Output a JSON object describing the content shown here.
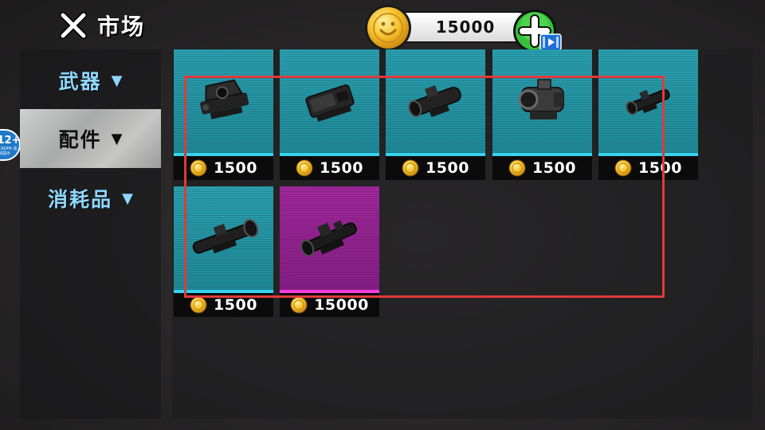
{
  "header": {
    "title": "市场",
    "close_icon": "close-x-icon"
  },
  "currency": {
    "coins": "15000",
    "coin_icon": "gold-coin-icon",
    "add_icon": "green-plus-icon",
    "video_icon": "video-ad-icon"
  },
  "sidebar": {
    "items": [
      {
        "label": "武器",
        "arrow": "▼",
        "active": false
      },
      {
        "label": "配件",
        "arrow": "▼",
        "active": true
      },
      {
        "label": "消耗品",
        "arrow": "▼",
        "active": false
      }
    ]
  },
  "age_badge": {
    "age": "12+",
    "small": "CADPA\n适龄提示"
  },
  "items": [
    {
      "icon": "red-dot-sight-icon",
      "price": "1500",
      "rarity": "blue"
    },
    {
      "icon": "holographic-sight-icon",
      "price": "1500",
      "rarity": "blue"
    },
    {
      "icon": "compact-scope-icon",
      "price": "1500",
      "rarity": "blue"
    },
    {
      "icon": "acog-scope-icon",
      "price": "1500",
      "rarity": "blue"
    },
    {
      "icon": "short-rifle-scope-icon",
      "price": "1500",
      "rarity": "blue"
    },
    {
      "icon": "long-rifle-scope-icon",
      "price": "1500",
      "rarity": "blue"
    },
    {
      "icon": "tactical-scope-icon",
      "price": "15000",
      "rarity": "purple"
    }
  ],
  "colors": {
    "sidebar_text": "#8fd7ff",
    "blue_card": "#2aa0b0",
    "purple_card": "#a0289c",
    "highlight": "#e03a3a"
  }
}
